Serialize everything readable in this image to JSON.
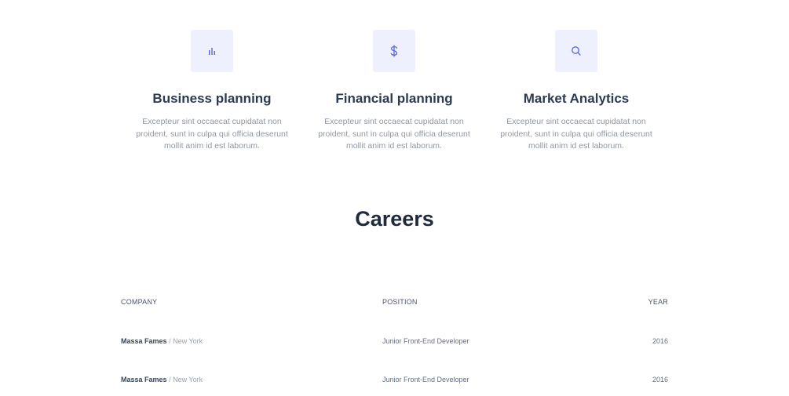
{
  "services": [
    {
      "icon": "bar-chart-icon",
      "title": "Business planning",
      "text": "Excepteur sint occaecat cupidatat non proident, sunt in culpa qui officia deserunt mollit anim id est laborum."
    },
    {
      "icon": "dollar-icon",
      "title": "Financial planning",
      "text": "Excepteur sint occaecat cupidatat non proident, sunt in culpa qui officia deserunt mollit anim id est laborum."
    },
    {
      "icon": "search-icon",
      "title": "Market Analytics",
      "text": "Excepteur sint occaecat cupidatat non proident, sunt in culpa qui officia deserunt mollit anim id est laborum."
    }
  ],
  "careers": {
    "title": "Careers",
    "headers": {
      "company": "COMPANY",
      "position": "POSITION",
      "year": "YEAR"
    },
    "rows": [
      {
        "company": "Massa Fames",
        "separator": "/",
        "city": "New York",
        "position": "Junior Front-End Developer",
        "year": "2016"
      },
      {
        "company": "Massa Fames",
        "separator": "/",
        "city": "New York",
        "position": "Junior Front-End Developer",
        "year": "2016"
      }
    ]
  },
  "colors": {
    "accent": "#5a63e6",
    "icon_bg": "#eef0fd",
    "heading": "#2d3a4f",
    "body_text": "#8f97a6"
  }
}
